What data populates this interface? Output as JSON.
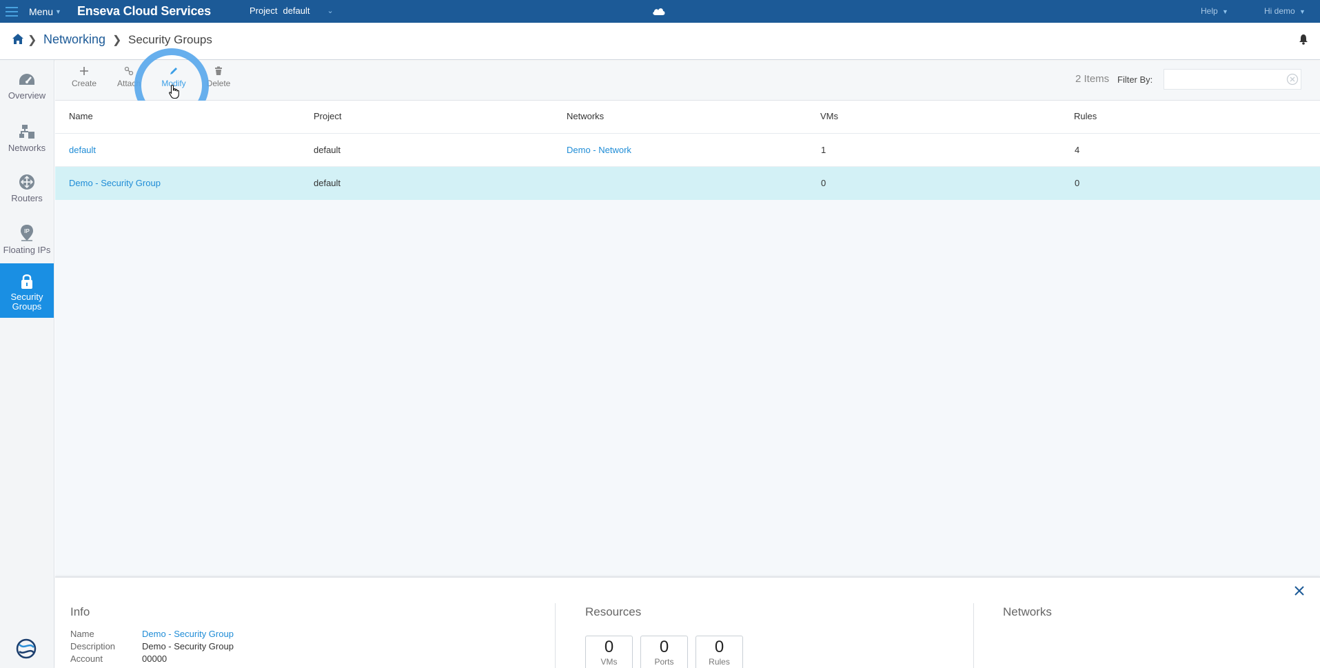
{
  "topbar": {
    "menu_label": "Menu",
    "brand": "Enseva Cloud Services",
    "project_label": "Project",
    "project_value": "default",
    "help_label": "Help",
    "user_label": "Hi demo"
  },
  "breadcrumb": {
    "parent": "Networking",
    "current": "Security Groups"
  },
  "sidebar": {
    "items": [
      {
        "label": "Overview"
      },
      {
        "label": "Networks"
      },
      {
        "label": "Routers"
      },
      {
        "label": "Floating IPs"
      },
      {
        "label_line1": "Security",
        "label_line2": "Groups",
        "active": true
      }
    ]
  },
  "toolbar": {
    "create_label": "Create",
    "attach_label": "Attach",
    "modify_label": "Modify",
    "delete_label": "Delete",
    "items_count": "2 Items",
    "filter_label": "Filter By:",
    "filter_value": ""
  },
  "table": {
    "columns": [
      "Name",
      "Project",
      "Networks",
      "VMs",
      "Rules"
    ],
    "rows": [
      {
        "name": "default",
        "project": "default",
        "networks": "Demo - Network",
        "vms": "1",
        "rules": "4"
      },
      {
        "name": "Demo - Security Group",
        "project": "default",
        "networks": "",
        "vms": "0",
        "rules": "0",
        "selected": true
      }
    ]
  },
  "details": {
    "info_title": "Info",
    "resources_title": "Resources",
    "networks_title": "Networks",
    "info": {
      "name_label": "Name",
      "name_value": "Demo - Security Group",
      "description_label": "Description",
      "description_value": "Demo - Security Group",
      "account_label": "Account",
      "account_value": "00000"
    },
    "resources": {
      "vms_count": "0",
      "vms_label": "VMs",
      "ports_count": "0",
      "ports_label": "Ports",
      "rules_count": "0",
      "rules_label": "Rules"
    }
  },
  "colors": {
    "topbar": "#1c5a97",
    "accent": "#1a8fe3",
    "link": "#1f8cd6",
    "selected_row": "#d3f1f6",
    "highlight_ring": "#5aa8ec"
  }
}
